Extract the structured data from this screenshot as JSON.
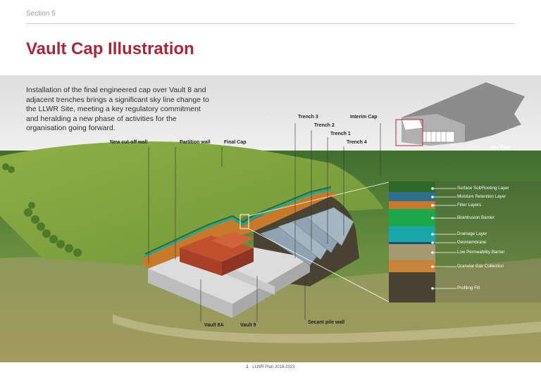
{
  "header": {
    "section": "Section 5",
    "title": "Vault Cap Illustration"
  },
  "intro_text": "Installation of the final engineered cap over Vault 8 and adjacent trenches brings a significant sky line change to the LLWR Site, meeting a key regulatory commitment and heralding a new phase of activities for the organisation going forward.",
  "labels": {
    "new_cutoff_wall": "New cut-off wall",
    "partition_wall": "Partition wall",
    "final_cap": "Final Cap",
    "trench3": "Trench 3",
    "trench2": "Trench 2",
    "trench1": "Trench 1",
    "trench4": "Trench 4",
    "interim_cap": "Interim Cap",
    "site_plan": "Site Plan",
    "vault8a": "Vault 8A",
    "vault9": "Vault 9",
    "secant_pile_wall": "Secant pile wall"
  },
  "layers": [
    {
      "name": "Surface Soil/Rooting Layer",
      "color": "#2d6a2a"
    },
    {
      "name": "Moisture Retention Layer",
      "color": "#2e6f8e"
    },
    {
      "name": "Filter Layers",
      "color": "#c77a2c"
    },
    {
      "name": "Biointrusion Barrier",
      "color": "#1ea64a"
    },
    {
      "name": "Drainage Layer",
      "color": "#1aa6a6"
    },
    {
      "name": "Geomembrane",
      "color": "#1b4f72"
    },
    {
      "name": "Low Permeability Barrier",
      "color": "#a59b72"
    },
    {
      "name": "Granular Gas Collection",
      "color": "#c9833a"
    },
    {
      "name": "Profiling Fill",
      "color": "#4a4232"
    }
  ],
  "footer": {
    "page_number": "1",
    "text": "LLWR Plan 2018-2023"
  },
  "colors": {
    "title": "#a6263a",
    "sky": "#e3e3e3",
    "grass": "#5d8a3c"
  }
}
